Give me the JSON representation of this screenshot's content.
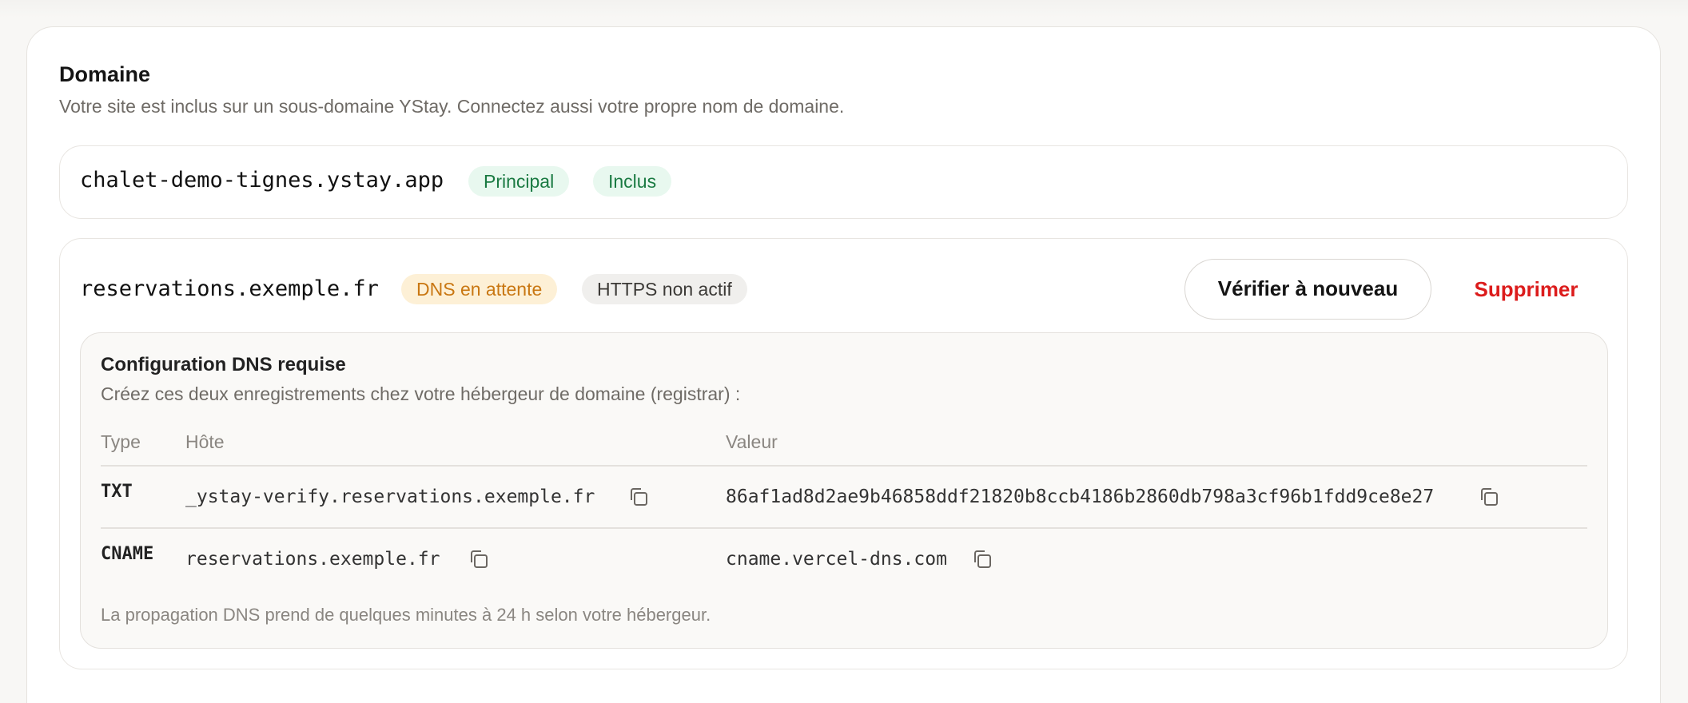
{
  "section": {
    "title": "Domaine",
    "description": "Votre site est inclus sur un sous-domaine YStay. Connectez aussi votre propre nom de domaine."
  },
  "primary_domain": {
    "name": "chalet-demo-tignes.ystay.app",
    "badges": [
      "Principal",
      "Inclus"
    ]
  },
  "custom_domain": {
    "name": "reservations.exemple.fr",
    "dns_status": "DNS en attente",
    "https_status": "HTTPS non actif",
    "verify_label": "Vérifier à nouveau",
    "delete_label": "Supprimer"
  },
  "dns_config": {
    "title": "Configuration DNS requise",
    "description": "Créez ces deux enregistrements chez votre hébergeur de domaine (registrar) :",
    "columns": [
      "Type",
      "Hôte",
      "Valeur"
    ],
    "rows": [
      {
        "type": "TXT",
        "host": "_ystay-verify.reservations.exemple.fr",
        "value": "86af1ad8d2ae9b46858ddf21820b8ccb4186b2860db798a3cf96b1fdd9ce8e27"
      },
      {
        "type": "CNAME",
        "host": "reservations.exemple.fr",
        "value": "cname.vercel-dns.com"
      }
    ],
    "footnote": "La propagation DNS prend de quelques minutes à 24 h selon votre hébergeur."
  },
  "icons": {
    "copy": "copy-icon"
  },
  "colors": {
    "success_badge_bg": "#e8f8ef",
    "success_badge_text": "#1a7a42",
    "warning_badge_bg": "#fdf0d6",
    "warning_badge_text": "#c97712",
    "danger": "#dc1c1c"
  }
}
